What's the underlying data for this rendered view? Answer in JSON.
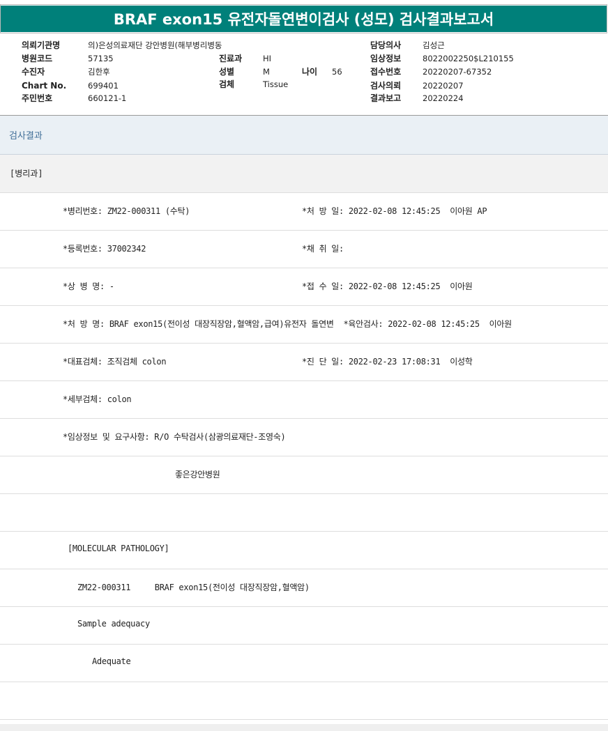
{
  "report_title": "BRAF exon15 유전자돌연변이검사 (성모) 검사결과보고서",
  "header": {
    "institution_label": "의뢰기관명",
    "institution_value": "의)은성의료재단 강안병원(해부병리병동",
    "hospital_code_label": "병원코드",
    "hospital_code_value": "57135",
    "patient_label": "수진자",
    "patient_value": "김한후",
    "chart_label": "Chart No.",
    "chart_value": "699401",
    "resident_label": "주민번호",
    "resident_value": "660121-1",
    "dept_label": "진료과",
    "dept_value": "HI",
    "sex_label": "성별",
    "sex_value": "M",
    "age_label": "나이",
    "age_value": "56",
    "specimen_label": "검체",
    "specimen_value": "Tissue",
    "doctor_label": "담당의사",
    "doctor_value": "김성근",
    "clinical_label": "임상정보",
    "clinical_value": "8022002250$L210155",
    "receipt_label": "접수번호",
    "receipt_value": "20220207-67352",
    "request_label": "검사의뢰",
    "request_value": "20220207",
    "result_label": "결과보고",
    "result_value": "20220224"
  },
  "section_title": "검사결과",
  "sub_title": "[병리과]",
  "rows": [
    {
      "left": "*병리번호: ZM22-000311 (수탁)",
      "right": "*처 방 일: 2022-02-08 12:45:25  이아원 AP"
    },
    {
      "left": "*등록번호: 37002342",
      "right": "*채 취 일:"
    },
    {
      "left": "*상 병 명: -",
      "right": "*접 수 일: 2022-02-08 12:45:25  이아원"
    },
    {
      "left": "*처 방 명: BRAF exon15(전이성 대장직장암,혈액암,급여)유전자 돌연변  *육안검사: 2022-02-08 12:45:25  이아원",
      "right": ""
    },
    {
      "left": "*대표검체: 조직검체 colon",
      "right": "*진 단 일: 2022-02-23 17:08:31  이성학"
    },
    {
      "left": "*세부검체: colon",
      "right": ""
    },
    {
      "left": "*임상정보 및 요구사항: R/O 수탁검사(삼광의료재단-조영숙)",
      "right": ""
    },
    {
      "left": "좋은강안병원",
      "right": ""
    },
    {
      "left": "",
      "right": ""
    },
    {
      "left": "[MOLECULAR PATHOLOGY]",
      "right": ""
    },
    {
      "left": "ZM22-000311     BRAF exon15(전이성 대장직장암,혈액암)",
      "right": ""
    },
    {
      "left": "Sample adequacy",
      "right": ""
    },
    {
      "left": "Adequate",
      "right": ""
    },
    {
      "left": "",
      "right": ""
    }
  ]
}
